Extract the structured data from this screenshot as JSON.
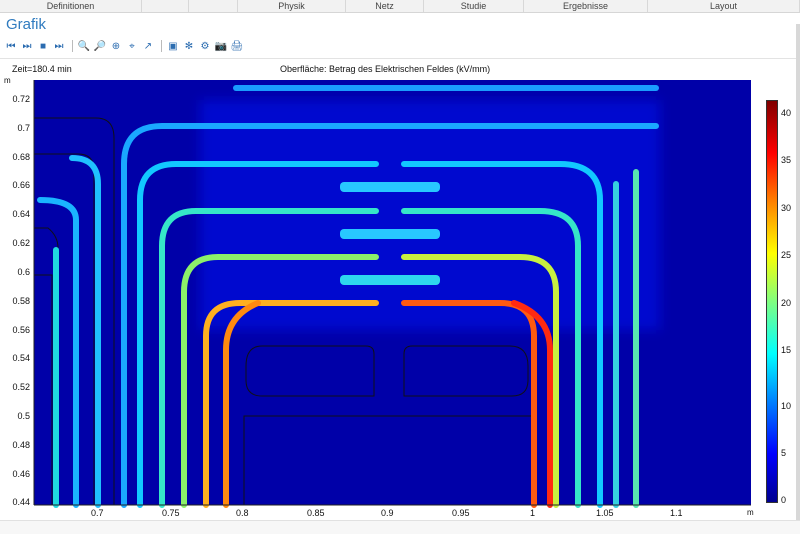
{
  "menu": [
    "Definitionen",
    "",
    "",
    "Physik",
    "Netz",
    "Studie",
    "Ergebnisse",
    "Layout"
  ],
  "panel": {
    "title": "Grafik"
  },
  "toolbar": [
    "prev-icon",
    "next-icon",
    "stop-icon",
    "last-icon",
    "zoom-in-icon",
    "zoom-out-icon",
    "zoom-box-icon",
    "zoom-extents-icon",
    "axes-icon",
    "select-icon",
    "grid-icon",
    "settings-icon",
    "camera-icon",
    "print-icon"
  ],
  "plot": {
    "time_label": "Zeit=180.4 min",
    "title": "Oberfläche: Betrag des Elektrischen Feldes (kV/mm)",
    "x_unit": "m",
    "y_unit": "m",
    "x_ticks": [
      "0.7",
      "0.75",
      "0.8",
      "0.85",
      "0.9",
      "0.95",
      "1",
      "1.05",
      "1.1"
    ],
    "y_ticks": [
      "0.72",
      "0.7",
      "0.68",
      "0.66",
      "0.64",
      "0.62",
      "0.6",
      "0.58",
      "0.56",
      "0.54",
      "0.52",
      "0.5",
      "0.48",
      "0.46",
      "0.44"
    ],
    "colorbar_ticks": [
      "40",
      "35",
      "30",
      "25",
      "20",
      "15",
      "10",
      "5",
      "0"
    ],
    "field_range_kv_per_mm": [
      0,
      42
    ]
  }
}
